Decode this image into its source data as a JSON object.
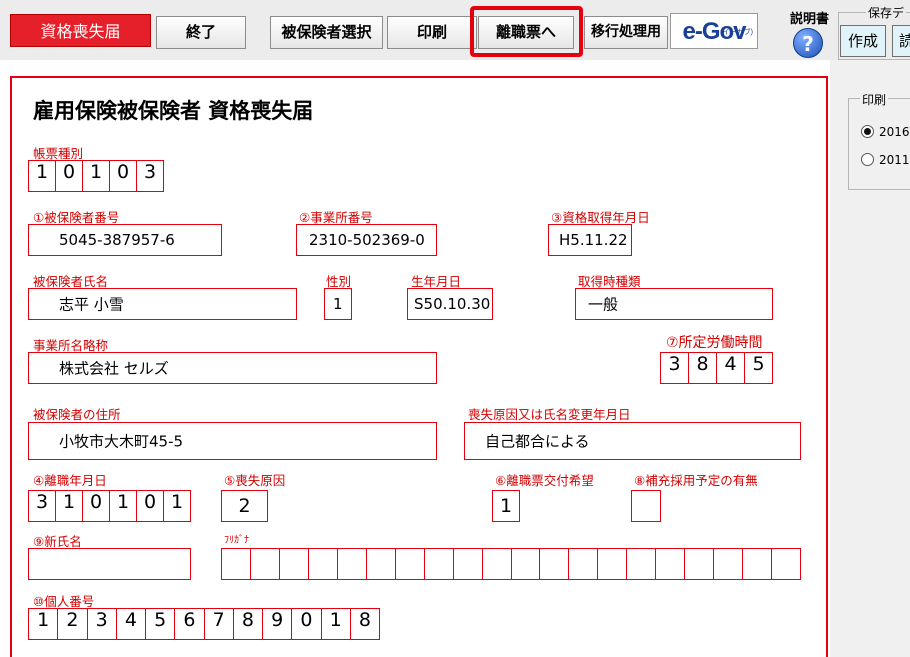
{
  "toolbar": {
    "title": "資格喪失届",
    "end_label": "終了",
    "select_insured_label": "被保険者選択",
    "print_label": "印刷",
    "to_separation_label": "離職票へ",
    "migration_label": "移行処理用",
    "egov_logo_text": "e-Gov",
    "egov_logo_sub": "(イーガブ)",
    "manual_label": "説明書",
    "save_group_label": "保存デ",
    "create_label": "作成",
    "read_label": "読"
  },
  "right_panel": {
    "print_group_label": "印刷",
    "print_options": [
      {
        "label": "2016",
        "selected": true
      },
      {
        "label": "2011",
        "selected": false
      }
    ]
  },
  "form": {
    "title": "雇用保険被保険者 資格喪失届",
    "form_type": {
      "label": "帳票種別",
      "digits": [
        "1",
        "0",
        "1",
        "0",
        "3"
      ]
    },
    "insured_number": {
      "label": "①被保険者番号",
      "value": "5045-387957-6"
    },
    "office_number": {
      "label": "②事業所番号",
      "value": "2310-502369-0"
    },
    "acquisition_date": {
      "label": "③資格取得年月日",
      "value": "H5.11.22"
    },
    "insured_name": {
      "label": "被保険者氏名",
      "value": "志平 小雪"
    },
    "gender": {
      "label": "性別",
      "value": "1"
    },
    "birth_date": {
      "label": "生年月日",
      "value": "S50.10.30"
    },
    "acquisition_type": {
      "label": "取得時種類",
      "value": "一般"
    },
    "office_name": {
      "label": "事業所名略称",
      "value": "株式会社 セルズ"
    },
    "working_hours": {
      "label": "⑦所定労働時間",
      "digits": [
        "3",
        "8",
        "4",
        "5"
      ]
    },
    "address": {
      "label": "被保険者の住所",
      "value": "小牧市大木町45-5"
    },
    "loss_reason": {
      "label": "喪失原因又は氏名変更年月日",
      "value": "自己都合による"
    },
    "separation_date": {
      "label": "④離職年月日",
      "digits": [
        "3",
        "1",
        "0",
        "1",
        "0",
        "1"
      ]
    },
    "loss_cause": {
      "label": "⑤喪失原因",
      "value": "2"
    },
    "separation_slip_request": {
      "label": "⑥離職票交付希望",
      "value": "1"
    },
    "replacement_plan": {
      "label": "⑧補充採用予定の有無",
      "value": ""
    },
    "new_name": {
      "label": "⑨新氏名",
      "value": ""
    },
    "furigana": {
      "label": "ﾌﾘｶﾞﾅ",
      "cells": 20
    },
    "personal_number": {
      "label": "⑩個人番号",
      "digits": [
        "1",
        "2",
        "3",
        "4",
        "5",
        "6",
        "7",
        "8",
        "9",
        "0",
        "1",
        "8"
      ]
    }
  },
  "colors": {
    "accent_red": "#e3000f",
    "label_red": "#d40000",
    "title_badge": "#e5202b",
    "egov_blue": "#1a3f98"
  }
}
